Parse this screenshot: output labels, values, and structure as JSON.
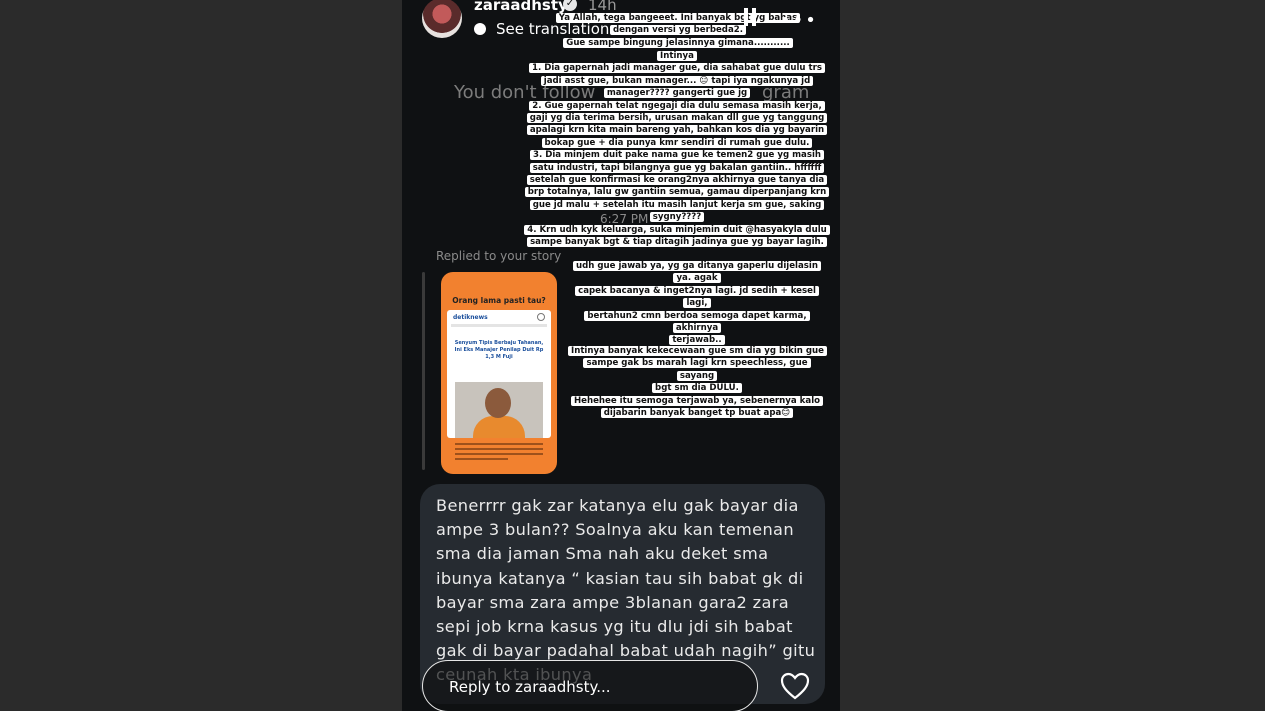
{
  "header": {
    "username": "zaraadhsty",
    "verified_icon": "verified-badge-icon",
    "time": "14h",
    "see_translation": "See translation"
  },
  "background_messages": {
    "not_following": "You don't follow",
    "not_following_end": "gram",
    "timestamp": "6:27 PM",
    "replied_label": "Replied to your story"
  },
  "story_captions": {
    "block_top": "Ya Allah, tega bangeeet. Ini banyak bgt yg bahas\ndengan versi yg berbeda2.\nGue sampe bingung jelasinnya gimana...........",
    "block_points": "Intinya\n1. Dia gapernah jadi manager gue, dia sahabat gue dulu trs\njadi asst gue, bukan manager... 😐 tapi iya ngakunya jd\nmanager???? gangerti gue jg\n2. Gue gapernah telat ngegaji dia dulu semasa masih kerja,\ngaji yg dia terima bersih, urusan makan dll gue yg tanggung\napalagi krn kita main bareng yah, bahkan kos dia yg bayarin\nbokap gue + dia punya kmr sendiri di rumah gue dulu.\n3. Dia minjem duit pake nama gue ke temen2 gue yg masih\nsatu industri, tapi bilangnya gue yg bakalan gantiin.. hffffff\nsetelah gue konfirmasi ke orang2nya akhirnya gue tanya dia\nbrp totalnya, lalu gw gantiin semua, gamau diperpanjang krn\ngue jd malu + setelah itu masih lanjut kerja sm gue, saking\nsygny????\n4. Krn udh kyk keluarga, suka minjemin duit @hasyakyla dulu\nsampe banyak bgt & tiap ditagih jadinya gue yg bayar lagih.",
    "block_answer": "udh gue jawab ya, yg ga ditanya gaperlu dijelasin ya. agak\ncapek bacanya & inget2nya lagi. jd sedih + kesel lagi,\nbertahun2 cmn berdoa semoga dapet karma, akhirnya\nterjawab..",
    "block_end": "Intinya banyak kekecewaan gue sm dia yg bikin gue\nsampe gak bs marah lagi krn speechless, gue sayang\nbgt sm dia DULU.\nHehehee itu semoga terjawab ya, sebenernya kalo\ndijabarin banyak banget tp buat apa😊"
  },
  "story_thumbnail": {
    "title": "Orang lama pasti tau?",
    "brand": "detiknews",
    "headline": "Senyum Tipis Berbaju Tahanan, Ini Eks Manajer Penilap Duit Rp 1,3 M Fuji"
  },
  "reply_bubble": {
    "text": "Benerrrr gak zar katanya elu gak bayar dia ampe 3 bulan?? Soalnya aku kan temenan sma dia jaman Sma nah aku deket sma ibunya katanya “ kasian tau sih babat gk di bayar sma zara ampe 3blanan gara2 zara sepi job krna kasus yg itu dlu jdi sih babat gak di bayar padahal babat udah nagih” gitu ceunah kta ibunya"
  },
  "reply_input": {
    "placeholder": "Reply to zaraadhsty..."
  },
  "icons": {
    "pause": "pause-icon",
    "more": "more-icon",
    "like": "heart-icon",
    "translate": "translate-icon"
  }
}
